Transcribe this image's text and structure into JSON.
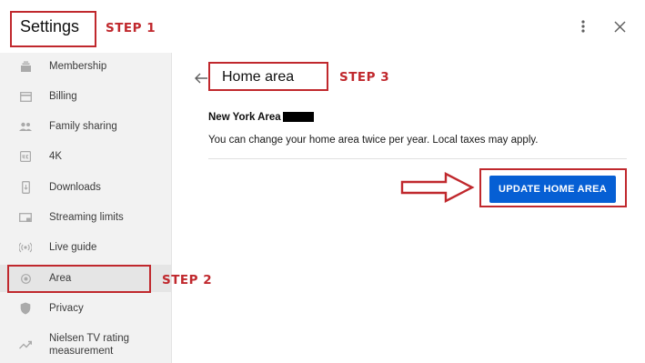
{
  "header": {
    "title": "Settings",
    "more_icon": "more-vert-icon",
    "close_icon": "close-icon"
  },
  "sidebar": {
    "items": [
      {
        "label": "Membership",
        "icon": "membership-icon"
      },
      {
        "label": "Billing",
        "icon": "credit-card-icon"
      },
      {
        "label": "Family sharing",
        "icon": "people-icon"
      },
      {
        "label": "4K",
        "icon": "4k-icon"
      },
      {
        "label": "Downloads",
        "icon": "phone-download-icon"
      },
      {
        "label": "Streaming limits",
        "icon": "cast-screen-icon"
      },
      {
        "label": "Live guide",
        "icon": "broadcast-icon"
      },
      {
        "label": "Area",
        "icon": "location-target-icon",
        "active": true
      },
      {
        "label": "Privacy",
        "icon": "shield-icon"
      },
      {
        "label": "Nielsen TV rating measurement",
        "icon": "trending-icon"
      }
    ]
  },
  "main": {
    "title": "Home area",
    "area_label": "New York Area -",
    "description": "You can change your home area twice per year. Local taxes may apply.",
    "update_button": "UPDATE HOME AREA"
  },
  "annotations": {
    "step1": "STEP 1",
    "step2": "STEP 2",
    "step3": "STEP 3",
    "color": "#c0282d"
  },
  "colors": {
    "accent": "#065fd4",
    "sidebar_bg": "#f2f2f2",
    "active_bg": "#e5e5e5"
  }
}
